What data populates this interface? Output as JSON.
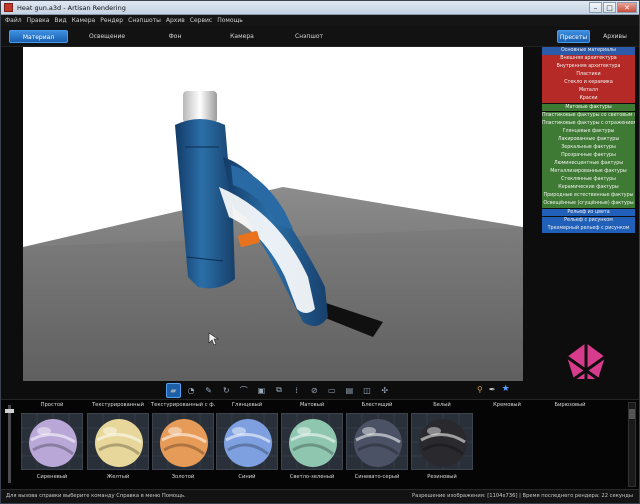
{
  "window": {
    "title": "Heat gun.a3d - Artisan Rendering"
  },
  "menu": [
    "Файл",
    "Правка",
    "Вид",
    "Камера",
    "Рендер",
    "Снэпшоты",
    "Архив",
    "Сервис",
    "Помощь"
  ],
  "tabs": {
    "material": "Материал",
    "lighting": "Освещение",
    "background": "Фон",
    "camera": "Камера",
    "snapshot": "Снэпшот",
    "presets": "Пресеты",
    "archives": "Архивы"
  },
  "material_categories": [
    {
      "label": "Основные материалы",
      "kind": "blue"
    },
    {
      "label": "Внешняя архитектура",
      "kind": "red"
    },
    {
      "label": "Внутренняя архитектура",
      "kind": "red"
    },
    {
      "label": "Пластики",
      "kind": "red"
    },
    {
      "label": "Стекло и керамика",
      "kind": "red"
    },
    {
      "label": "Металл",
      "kind": "red"
    },
    {
      "label": "Краски",
      "kind": "red"
    },
    {
      "label": "Матовые фактуры",
      "kind": "green"
    },
    {
      "label": "Пластиковые фактуры со световым эф.",
      "kind": "green"
    },
    {
      "label": "Пластиковые фактуры с отражением",
      "kind": "green"
    },
    {
      "label": "Глянцевые фактуры",
      "kind": "green"
    },
    {
      "label": "Лакированные фактуры",
      "kind": "green"
    },
    {
      "label": "Зеркальные фактуры",
      "kind": "green"
    },
    {
      "label": "Прозрачные фактуры",
      "kind": "green"
    },
    {
      "label": "Люминесцентные фактуры",
      "kind": "green"
    },
    {
      "label": "Металлизированные фактуры",
      "kind": "green"
    },
    {
      "label": "Стеклянные фактуры",
      "kind": "green"
    },
    {
      "label": "Керамические фактуры",
      "kind": "green"
    },
    {
      "label": "Природные естественные фактуры",
      "kind": "green"
    },
    {
      "label": "Освещённые (сгущённые) фактуры",
      "kind": "green"
    },
    {
      "label": "Рельеф из цвета",
      "kind": "blue2"
    },
    {
      "label": "Рельеф с рисунком",
      "kind": "blue2"
    },
    {
      "label": "Трехмерный рельеф с рисунком",
      "kind": "blue2"
    }
  ],
  "swatches": [
    {
      "top": "Простой",
      "bottom": "Сиреневый",
      "color": "#b9a7d8"
    },
    {
      "top": "Текстурированный",
      "bottom": "Желтый",
      "color": "#e8d79a"
    },
    {
      "top": "Текстурированный с ф.",
      "bottom": "Золотой",
      "color": "#e79b58"
    },
    {
      "top": "Глянцевый",
      "bottom": "Синий",
      "color": "#7ea0e0"
    },
    {
      "top": "Матовый",
      "bottom": "Светло-зеленый",
      "color": "#8fc6b0"
    },
    {
      "top": "Блестящий",
      "bottom": "Синевато-серый",
      "color": "#4b5266"
    },
    {
      "top": "Белый",
      "bottom": "Резиновый",
      "color": "#2a2a2e"
    },
    {
      "top": "Кремовый",
      "bottom": "",
      "color": ""
    },
    {
      "top": "Бирюзовый",
      "bottom": "",
      "color": ""
    }
  ],
  "status": {
    "help": "Для вызова справки выберите команду Справка в меню Помощь.",
    "info": "Разрешение изображения: [1104x736]  |  Время последнего рендера: 22 секунды"
  },
  "colors": {
    "accent": "#1f6fd0",
    "product": "#1d5a8e",
    "trigger": "#e8731c"
  }
}
